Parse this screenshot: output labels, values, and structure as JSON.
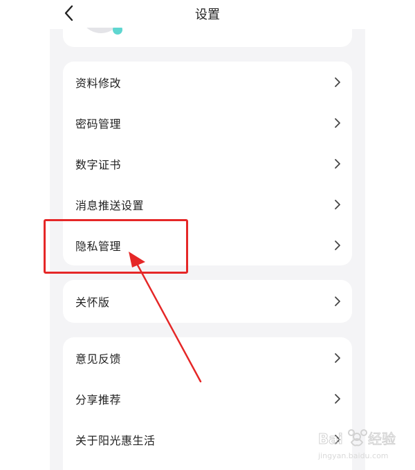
{
  "header": {
    "title": "设置",
    "back_icon": "chevron-left-icon"
  },
  "groups": [
    {
      "items": [
        {
          "label": "资料修改"
        },
        {
          "label": "密码管理"
        },
        {
          "label": "数字证书"
        },
        {
          "label": "消息推送设置"
        },
        {
          "label": "隐私管理"
        }
      ]
    },
    {
      "items": [
        {
          "label": "关怀版"
        }
      ]
    },
    {
      "items": [
        {
          "label": "意见反馈"
        },
        {
          "label": "分享推荐"
        },
        {
          "label": "关于阳光惠生活"
        }
      ]
    }
  ],
  "annotation": {
    "color": "#e52727",
    "target": "隐私管理"
  },
  "watermark": {
    "brand": "Bai",
    "brand2": "经验",
    "url": "jingyan.baidu.com"
  },
  "colors": {
    "background": "#f4f4f6",
    "card": "#ffffff",
    "accent_badge": "#5fd6d0"
  }
}
